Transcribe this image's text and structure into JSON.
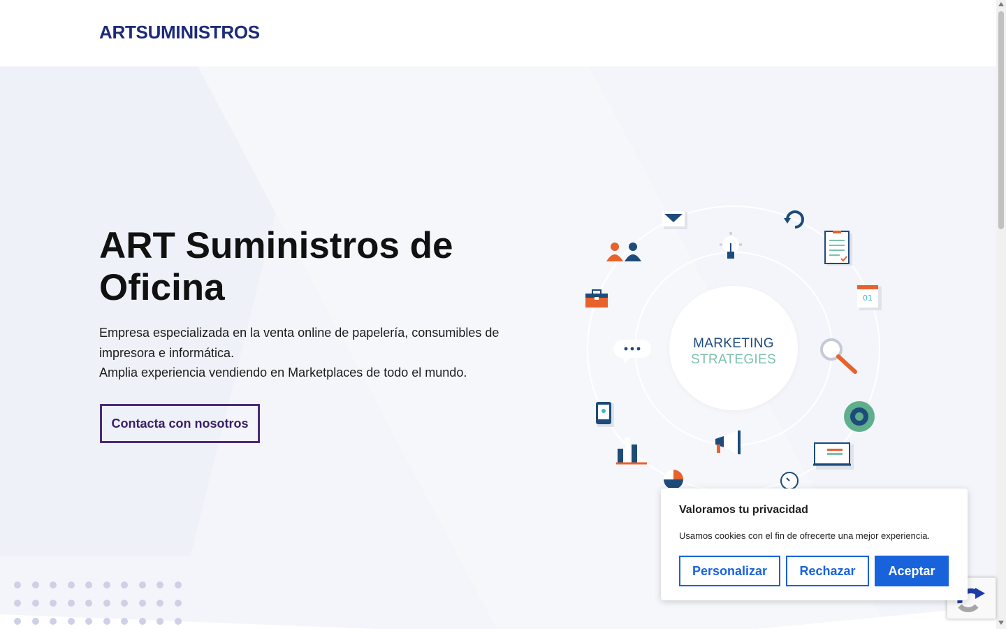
{
  "header": {
    "logo": "ARTSUMINISTROS"
  },
  "hero": {
    "title": "ART Suministros de Oficina",
    "description_line1": "Empresa especializada en la venta online de papelería, consumibles de impresora e informática.",
    "description_line2": "Amplia experiencia vendiendo en Marketplaces de todo el mundo.",
    "cta_label": "Contacta con nosotros"
  },
  "illustration": {
    "line1": "MARKETING",
    "line2": "STRATEGIES",
    "calendar_text": "01",
    "icons": [
      "envelope-icon",
      "refresh-icon",
      "document-icon",
      "calendar-icon",
      "magnifier-icon",
      "gear-icon",
      "laptop-icon",
      "clock-icon",
      "pie-chart-icon",
      "bar-chart-icon",
      "tablet-icon",
      "chat-bubble-icon",
      "briefcase-icon",
      "people-icon",
      "lightbulb-icon",
      "megaphone-icon"
    ]
  },
  "cookie": {
    "title": "Valoramos tu privacidad",
    "text": "Usamos cookies con el fin de ofrecerte una mejor experiencia.",
    "customize_label": "Personalizar",
    "reject_label": "Rechazar",
    "accept_label": "Aceptar"
  },
  "colors": {
    "brand": "#1c2b7a",
    "cta_border": "#4b2a7a",
    "cookie_accent": "#1863dc",
    "hero_bg": "#f3f5fa"
  }
}
